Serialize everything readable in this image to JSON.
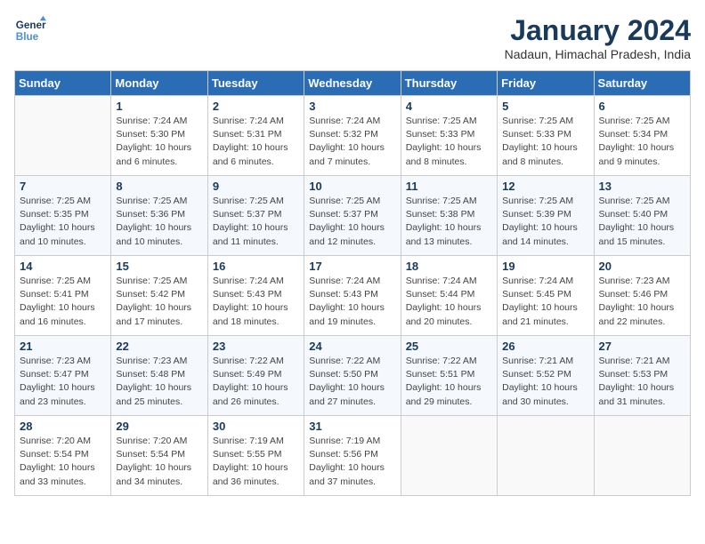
{
  "header": {
    "logo_line1": "General",
    "logo_line2": "Blue",
    "month_title": "January 2024",
    "location": "Nadaun, Himachal Pradesh, India"
  },
  "days_of_week": [
    "Sunday",
    "Monday",
    "Tuesday",
    "Wednesday",
    "Thursday",
    "Friday",
    "Saturday"
  ],
  "weeks": [
    [
      {
        "num": "",
        "info": ""
      },
      {
        "num": "1",
        "info": "Sunrise: 7:24 AM\nSunset: 5:30 PM\nDaylight: 10 hours\nand 6 minutes."
      },
      {
        "num": "2",
        "info": "Sunrise: 7:24 AM\nSunset: 5:31 PM\nDaylight: 10 hours\nand 6 minutes."
      },
      {
        "num": "3",
        "info": "Sunrise: 7:24 AM\nSunset: 5:32 PM\nDaylight: 10 hours\nand 7 minutes."
      },
      {
        "num": "4",
        "info": "Sunrise: 7:25 AM\nSunset: 5:33 PM\nDaylight: 10 hours\nand 8 minutes."
      },
      {
        "num": "5",
        "info": "Sunrise: 7:25 AM\nSunset: 5:33 PM\nDaylight: 10 hours\nand 8 minutes."
      },
      {
        "num": "6",
        "info": "Sunrise: 7:25 AM\nSunset: 5:34 PM\nDaylight: 10 hours\nand 9 minutes."
      }
    ],
    [
      {
        "num": "7",
        "info": "Sunrise: 7:25 AM\nSunset: 5:35 PM\nDaylight: 10 hours\nand 10 minutes."
      },
      {
        "num": "8",
        "info": "Sunrise: 7:25 AM\nSunset: 5:36 PM\nDaylight: 10 hours\nand 10 minutes."
      },
      {
        "num": "9",
        "info": "Sunrise: 7:25 AM\nSunset: 5:37 PM\nDaylight: 10 hours\nand 11 minutes."
      },
      {
        "num": "10",
        "info": "Sunrise: 7:25 AM\nSunset: 5:37 PM\nDaylight: 10 hours\nand 12 minutes."
      },
      {
        "num": "11",
        "info": "Sunrise: 7:25 AM\nSunset: 5:38 PM\nDaylight: 10 hours\nand 13 minutes."
      },
      {
        "num": "12",
        "info": "Sunrise: 7:25 AM\nSunset: 5:39 PM\nDaylight: 10 hours\nand 14 minutes."
      },
      {
        "num": "13",
        "info": "Sunrise: 7:25 AM\nSunset: 5:40 PM\nDaylight: 10 hours\nand 15 minutes."
      }
    ],
    [
      {
        "num": "14",
        "info": "Sunrise: 7:25 AM\nSunset: 5:41 PM\nDaylight: 10 hours\nand 16 minutes."
      },
      {
        "num": "15",
        "info": "Sunrise: 7:25 AM\nSunset: 5:42 PM\nDaylight: 10 hours\nand 17 minutes."
      },
      {
        "num": "16",
        "info": "Sunrise: 7:24 AM\nSunset: 5:43 PM\nDaylight: 10 hours\nand 18 minutes."
      },
      {
        "num": "17",
        "info": "Sunrise: 7:24 AM\nSunset: 5:43 PM\nDaylight: 10 hours\nand 19 minutes."
      },
      {
        "num": "18",
        "info": "Sunrise: 7:24 AM\nSunset: 5:44 PM\nDaylight: 10 hours\nand 20 minutes."
      },
      {
        "num": "19",
        "info": "Sunrise: 7:24 AM\nSunset: 5:45 PM\nDaylight: 10 hours\nand 21 minutes."
      },
      {
        "num": "20",
        "info": "Sunrise: 7:23 AM\nSunset: 5:46 PM\nDaylight: 10 hours\nand 22 minutes."
      }
    ],
    [
      {
        "num": "21",
        "info": "Sunrise: 7:23 AM\nSunset: 5:47 PM\nDaylight: 10 hours\nand 23 minutes."
      },
      {
        "num": "22",
        "info": "Sunrise: 7:23 AM\nSunset: 5:48 PM\nDaylight: 10 hours\nand 25 minutes."
      },
      {
        "num": "23",
        "info": "Sunrise: 7:22 AM\nSunset: 5:49 PM\nDaylight: 10 hours\nand 26 minutes."
      },
      {
        "num": "24",
        "info": "Sunrise: 7:22 AM\nSunset: 5:50 PM\nDaylight: 10 hours\nand 27 minutes."
      },
      {
        "num": "25",
        "info": "Sunrise: 7:22 AM\nSunset: 5:51 PM\nDaylight: 10 hours\nand 29 minutes."
      },
      {
        "num": "26",
        "info": "Sunrise: 7:21 AM\nSunset: 5:52 PM\nDaylight: 10 hours\nand 30 minutes."
      },
      {
        "num": "27",
        "info": "Sunrise: 7:21 AM\nSunset: 5:53 PM\nDaylight: 10 hours\nand 31 minutes."
      }
    ],
    [
      {
        "num": "28",
        "info": "Sunrise: 7:20 AM\nSunset: 5:54 PM\nDaylight: 10 hours\nand 33 minutes."
      },
      {
        "num": "29",
        "info": "Sunrise: 7:20 AM\nSunset: 5:54 PM\nDaylight: 10 hours\nand 34 minutes."
      },
      {
        "num": "30",
        "info": "Sunrise: 7:19 AM\nSunset: 5:55 PM\nDaylight: 10 hours\nand 36 minutes."
      },
      {
        "num": "31",
        "info": "Sunrise: 7:19 AM\nSunset: 5:56 PM\nDaylight: 10 hours\nand 37 minutes."
      },
      {
        "num": "",
        "info": ""
      },
      {
        "num": "",
        "info": ""
      },
      {
        "num": "",
        "info": ""
      }
    ]
  ]
}
